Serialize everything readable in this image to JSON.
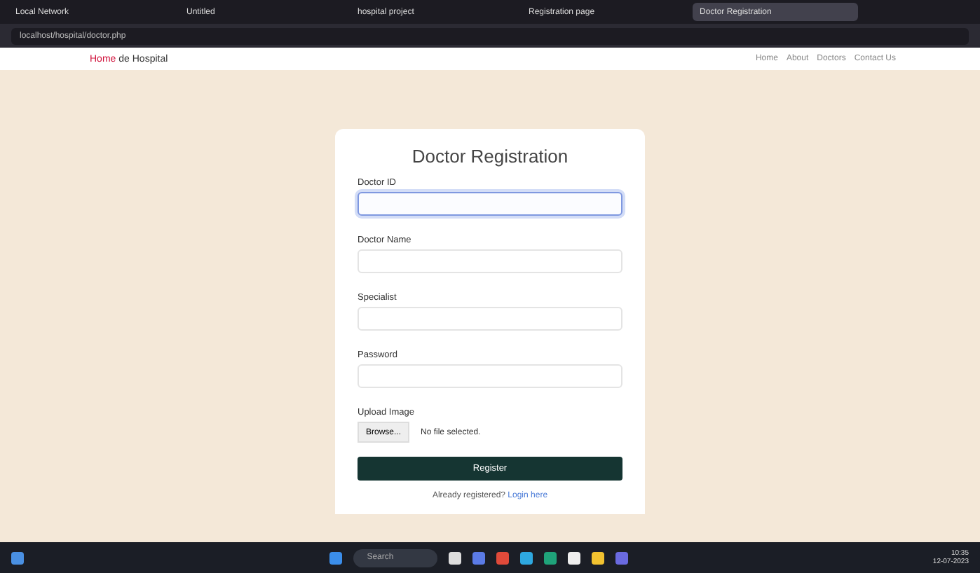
{
  "browser": {
    "tabs": [
      {
        "title": "Local Network",
        "selected": false
      },
      {
        "title": "Untitled",
        "selected": false
      },
      {
        "title": "hospital project",
        "selected": false
      },
      {
        "title": "Registration page",
        "selected": false
      },
      {
        "title": "Doctor Registration",
        "selected": true
      }
    ],
    "address": "localhost/hospital/doctor.php"
  },
  "navbar": {
    "brand_accent": "Home",
    "brand": "de Hospital",
    "links": [
      "Home",
      "About",
      "Doctors",
      "Contact Us"
    ]
  },
  "form": {
    "title": "Doctor Registration",
    "fields": [
      {
        "kind": "text",
        "label": "Doctor ID",
        "focused": true
      },
      {
        "kind": "text",
        "label": "Doctor Name",
        "focused": false
      },
      {
        "kind": "text",
        "label": "Specialist",
        "focused": false
      },
      {
        "kind": "password",
        "label": "Password",
        "focused": false
      },
      {
        "kind": "file",
        "label": "Upload Image",
        "button": "Browse...",
        "status": "No file selected."
      }
    ],
    "submit": "Register",
    "footer": "Already registered?",
    "footer_link": "Login here"
  },
  "taskbar": {
    "search_placeholder": "Search",
    "time": "10:35",
    "date": "12-07-2023"
  }
}
